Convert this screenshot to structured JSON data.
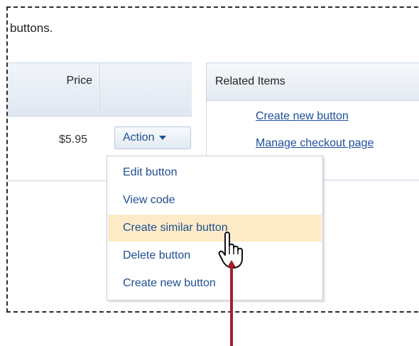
{
  "intro_text": "buttons.",
  "table": {
    "price_header": "Price",
    "row": {
      "price": "$5.95",
      "action_label": "Action"
    }
  },
  "related": {
    "title": "Related Items",
    "links": [
      "Create new button",
      "Manage checkout page"
    ]
  },
  "menu": {
    "items": [
      {
        "label": "Edit button"
      },
      {
        "label": "View code"
      },
      {
        "label": "Create similar button",
        "highlighted": true
      },
      {
        "label": "Delete button"
      },
      {
        "label": "Create new button"
      }
    ]
  },
  "icons": {
    "cursor": "hand-pointer-icon",
    "caret": "caret-down-icon",
    "arrow": "callout-arrow-icon"
  },
  "colors": {
    "link": "#1d4f9a",
    "highlight": "#fdebc8",
    "arrow": "#a31f2d"
  }
}
